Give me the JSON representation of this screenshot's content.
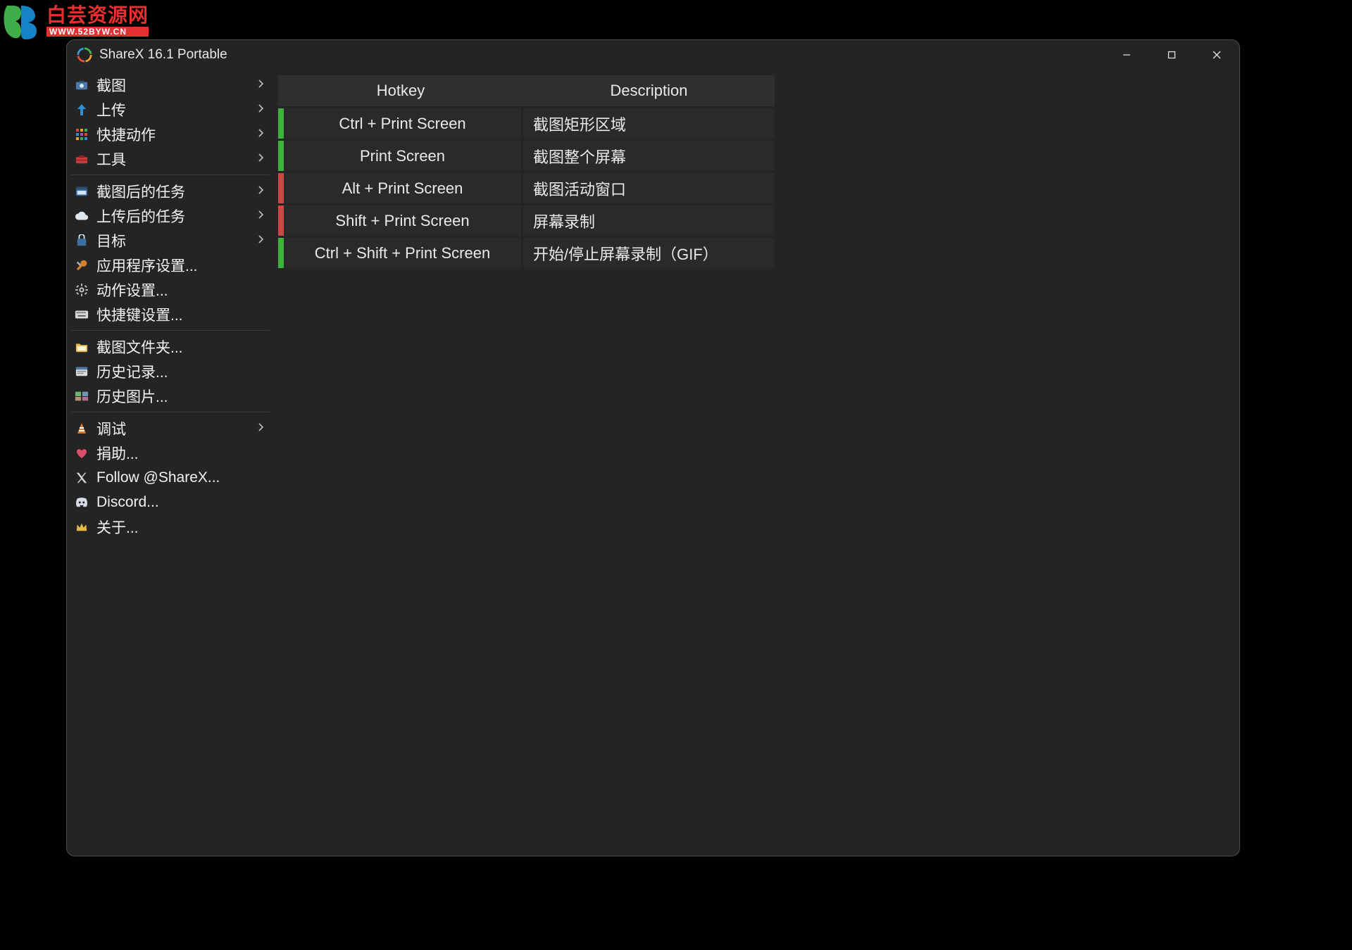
{
  "watermark": {
    "cn": "白芸资源网",
    "url": "WWW.52BYW.CN"
  },
  "window": {
    "title": "ShareX 16.1 Portable"
  },
  "sidebar": {
    "groups": [
      [
        {
          "id": "capture",
          "icon": "camera",
          "label": "截图",
          "sub": true
        },
        {
          "id": "upload",
          "icon": "arrow-up",
          "label": "上传",
          "sub": true
        },
        {
          "id": "quick-actions",
          "icon": "grid",
          "label": "快捷动作",
          "sub": true
        },
        {
          "id": "tools",
          "icon": "toolbox",
          "label": "工具",
          "sub": true
        }
      ],
      [
        {
          "id": "after-capture",
          "icon": "window",
          "label": "截图后的任务",
          "sub": true
        },
        {
          "id": "after-upload",
          "icon": "cloud",
          "label": "上传后的任务",
          "sub": true
        },
        {
          "id": "target",
          "icon": "target",
          "label": "目标",
          "sub": true
        },
        {
          "id": "app-settings",
          "icon": "wrench",
          "label": "应用程序设置...",
          "sub": false
        },
        {
          "id": "action-settings",
          "icon": "gear",
          "label": "动作设置...",
          "sub": false
        },
        {
          "id": "hotkey-settings",
          "icon": "keyboard",
          "label": "快捷键设置...",
          "sub": false
        }
      ],
      [
        {
          "id": "screenshot-folder",
          "icon": "folder",
          "label": "截图文件夹...",
          "sub": false
        },
        {
          "id": "history",
          "icon": "history",
          "label": "历史记录...",
          "sub": false
        },
        {
          "id": "image-history",
          "icon": "images",
          "label": "历史图片...",
          "sub": false
        }
      ],
      [
        {
          "id": "debug",
          "icon": "cone",
          "label": "调试",
          "sub": true
        },
        {
          "id": "donate",
          "icon": "heart",
          "label": "捐助...",
          "sub": false
        },
        {
          "id": "follow",
          "icon": "x",
          "label": "Follow @ShareX...",
          "sub": false
        },
        {
          "id": "discord",
          "icon": "discord",
          "label": "Discord...",
          "sub": false
        },
        {
          "id": "about",
          "icon": "crown",
          "label": "关于...",
          "sub": false
        }
      ]
    ]
  },
  "table": {
    "headers": {
      "hotkey": "Hotkey",
      "description": "Description"
    },
    "rows": [
      {
        "color": "green",
        "hotkey": "Ctrl + Print Screen",
        "desc": "截图矩形区域"
      },
      {
        "color": "green",
        "hotkey": "Print Screen",
        "desc": "截图整个屏幕"
      },
      {
        "color": "red",
        "hotkey": "Alt + Print Screen",
        "desc": "截图活动窗口"
      },
      {
        "color": "red",
        "hotkey": "Shift + Print Screen",
        "desc": "屏幕录制"
      },
      {
        "color": "green",
        "hotkey": "Ctrl + Shift + Print Screen",
        "desc": "开始/停止屏幕录制（GIF）"
      }
    ]
  }
}
